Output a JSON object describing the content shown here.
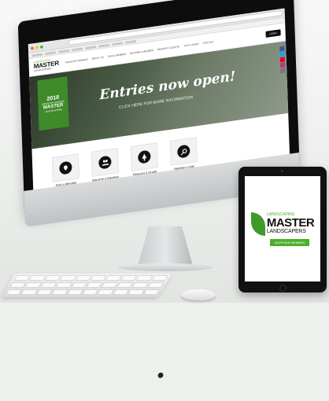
{
  "colors": {
    "brand_green": "#4caf2a",
    "award_green": "#3f8a2a",
    "dark": "#111111"
  },
  "site": {
    "logo": {
      "line1": "LANDSCAPING",
      "line2": "MASTER",
      "line3": "LANDSCAPERS"
    },
    "nav": [
      "INDUSTRY AWARDS",
      "ABOUT US",
      "FIND A MEMBER",
      "BECOME A MEMBER",
      "REQUEST A QUOTE",
      "TIPS & IDEAS",
      "CONTACT"
    ],
    "login_label": "LOGIN"
  },
  "hero": {
    "title": "Entries now open!",
    "subtitle": "CLICK HERE FOR MORE INFORMATION",
    "award": {
      "year": "2018",
      "line1": "INDUSTRY AWARDS",
      "line2": "MASTER",
      "line3": "LANDSCAPERS"
    }
  },
  "tiles": [
    {
      "label": "Find a Member",
      "icon": "location-icon"
    },
    {
      "label": "Become a Member",
      "icon": "people-icon"
    },
    {
      "label": "Request a Quote",
      "icon": "tree-icon"
    },
    {
      "label": "Member Login",
      "icon": "key-icon"
    }
  ],
  "social": [
    "facebook-icon",
    "twitter-icon",
    "pinterest-icon",
    "instagram-icon",
    "email-icon"
  ],
  "tablet": {
    "line1": "LANDSCAPING",
    "line2": "MASTER",
    "line3": "LANDSCAPERS",
    "badge": "SUPPLIER MEMBER"
  }
}
